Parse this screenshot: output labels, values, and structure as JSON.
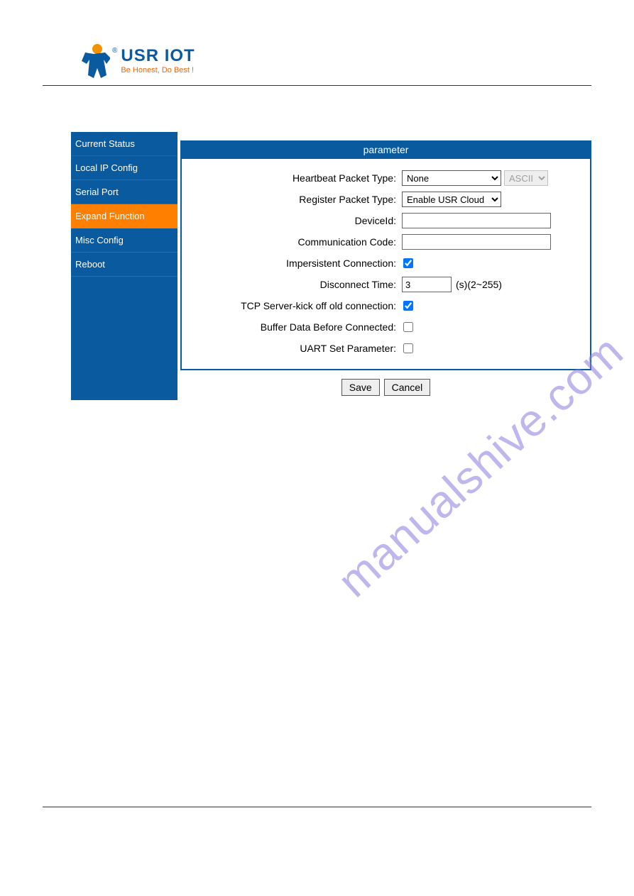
{
  "brand": {
    "name": "USR IOT",
    "tagline": "Be Honest, Do Best !",
    "reg": "®"
  },
  "watermark": "manualshive.com",
  "sidebar": {
    "items": [
      {
        "label": "Current Status",
        "active": false
      },
      {
        "label": "Local IP Config",
        "active": false
      },
      {
        "label": "Serial Port",
        "active": false
      },
      {
        "label": "Expand Function",
        "active": true
      },
      {
        "label": "Misc Config",
        "active": false
      },
      {
        "label": "Reboot",
        "active": false
      }
    ]
  },
  "panel": {
    "title": "parameter",
    "rows": {
      "heartbeat_label": "Heartbeat Packet Type:",
      "heartbeat_value": "None",
      "heartbeat_ascii": "ASCII",
      "register_label": "Register Packet Type:",
      "register_value": "Enable USR Cloud",
      "deviceid_label": "DeviceId:",
      "deviceid_value": "",
      "commcode_label": "Communication Code:",
      "commcode_value": "",
      "impersistent_label": "Impersistent Connection:",
      "impersistent_checked": true,
      "disconnect_label": "Disconnect Time:",
      "disconnect_value": "3",
      "disconnect_suffix": "(s)(2~255)",
      "kickoff_label": "TCP Server-kick off old connection:",
      "kickoff_checked": true,
      "buffer_label": "Buffer Data Before Connected:",
      "buffer_checked": false,
      "uart_label": "UART Set Parameter:",
      "uart_checked": false
    },
    "buttons": {
      "save": "Save",
      "cancel": "Cancel"
    }
  }
}
